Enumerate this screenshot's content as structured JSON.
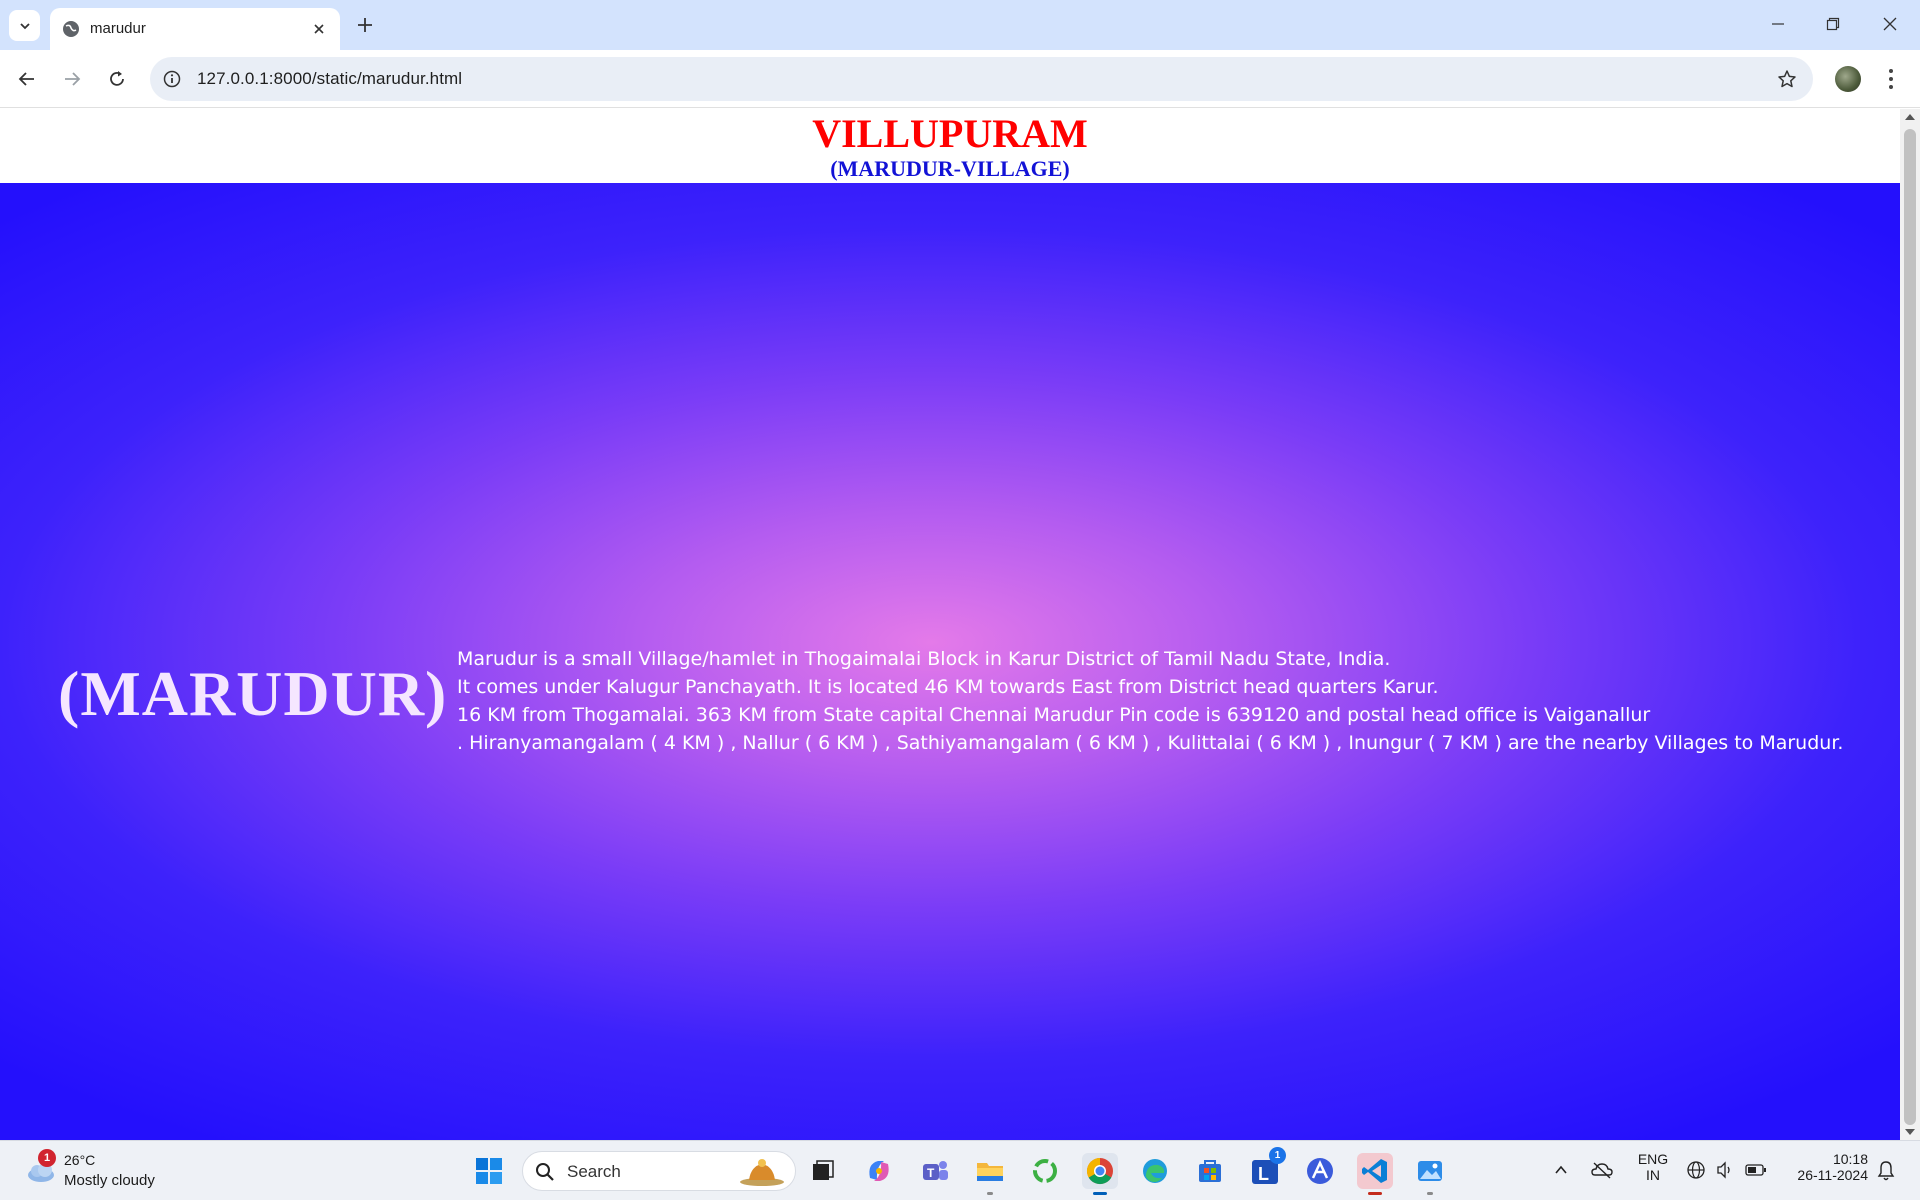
{
  "browser": {
    "tab_title": "marudur",
    "url": "127.0.0.1:8000/static/marudur.html"
  },
  "page": {
    "title": "VILLUPURAM",
    "subtitle": "(MARUDUR-VILLAGE)",
    "hero_title": "(MARUDUR)",
    "paragraph_lines": [
      "Marudur is a small Village/hamlet in Thogaimalai Block in Karur District of Tamil Nadu State, India.",
      "It comes under Kalugur Panchayath. It is located 46 KM towards East from District head quarters Karur.",
      "16 KM from Thogamalai. 363 KM from State capital Chennai Marudur Pin code is 639120 and postal head office is Vaiganallur",
      ". Hiranyamangalam ( 4 KM ) , Nallur ( 6 KM ) , Sathiyamangalam ( 6 KM ) , Kulittalai ( 6 KM ) , Inungur ( 7 KM ) are the nearby Villages to Marudur."
    ],
    "colors": {
      "title": "#ff0000",
      "subtitle": "#1212d6",
      "background_outer": "#2410fc",
      "background_center": "#e47ae9"
    }
  },
  "taskbar": {
    "weather": {
      "badge": "1",
      "temperature": "26°C",
      "condition": "Mostly cloudy"
    },
    "search_placeholder": "Search",
    "pinned_apps": [
      "start-icon",
      "task-view-icon",
      "copilot-icon",
      "teams-icon",
      "file-explorer-icon",
      "refresh-app-icon",
      "chrome-icon",
      "edge-icon",
      "microsoft-store-icon",
      "l-app-icon",
      "vector-app-icon",
      "vscode-icon",
      "photos-icon"
    ],
    "l_app_badge": "1",
    "language": {
      "line1": "ENG",
      "line2": "IN"
    },
    "clock": {
      "time": "10:18",
      "date": "26-11-2024"
    }
  }
}
